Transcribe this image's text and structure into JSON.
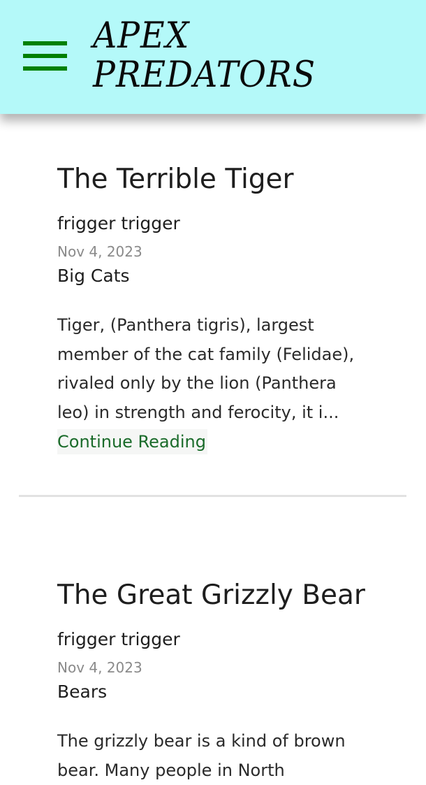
{
  "header": {
    "logo_line1": "APEX",
    "logo_line2": "PREDATORS",
    "background_color": "#b4f9f9",
    "menu_color": "#008000"
  },
  "menu_icon": "hamburger-menu-icon",
  "posts": [
    {
      "title": "The Terrible Tiger",
      "author": "frigger trigger",
      "date": "Nov 4, 2023",
      "category": "Big Cats",
      "excerpt": "Tiger, (Panthera tigris), largest member of the cat family (Felidae), rivaled only by the lion (Panthera leo) in strength and ferocity, it i...",
      "read_more": "Continue Reading"
    },
    {
      "title": "The Great Grizzly Bear",
      "author": "frigger trigger",
      "date": "Nov 4, 2023",
      "category": "Bears",
      "excerpt": "The grizzly bear is a kind of brown bear. Many people in North"
    }
  ],
  "link_color": "#1a6b2a"
}
